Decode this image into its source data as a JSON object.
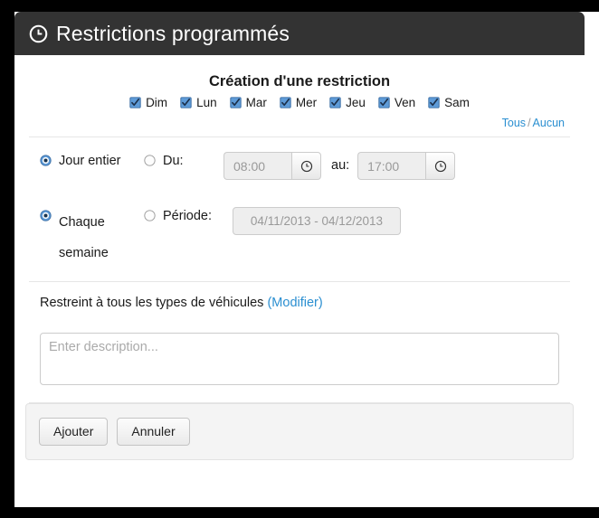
{
  "header": {
    "title": "Restrictions programmés",
    "icon": "clock-icon"
  },
  "form": {
    "title": "Création d'une restriction",
    "days": [
      {
        "label": "Dim",
        "checked": true
      },
      {
        "label": "Lun",
        "checked": true
      },
      {
        "label": "Mar",
        "checked": true
      },
      {
        "label": "Mer",
        "checked": true
      },
      {
        "label": "Jeu",
        "checked": true
      },
      {
        "label": "Ven",
        "checked": true
      },
      {
        "label": "Sam",
        "checked": true
      }
    ],
    "toggle": {
      "all": "Tous",
      "separator": "/",
      "none": "Aucun"
    },
    "time_row": {
      "full_day_label": "Jour entier",
      "full_day_selected": true,
      "from_label": "Du:",
      "from_selected": false,
      "from_value": "08:00",
      "to_label": "au:",
      "to_value": "17:00",
      "from_icon": "clock-icon",
      "to_icon": "clock-icon"
    },
    "period_row": {
      "weekly_label_line1": "Chaque",
      "weekly_label_line2": "semaine",
      "weekly_selected": true,
      "period_label": "Période:",
      "period_selected": false,
      "period_value": "04/11/2013 - 04/12/2013"
    },
    "vehicles": {
      "text": "Restreint à tous les types de véhicules",
      "link": "(Modifier)"
    },
    "description": {
      "value": "",
      "placeholder": "Enter description..."
    }
  },
  "footer": {
    "submit_label": "Ajouter",
    "cancel_label": "Annuler"
  },
  "colors": {
    "header_bg": "#333333",
    "link": "#2b8fd1",
    "checkbox_accent": "#3b7fd4",
    "disabled_text": "#999999"
  }
}
